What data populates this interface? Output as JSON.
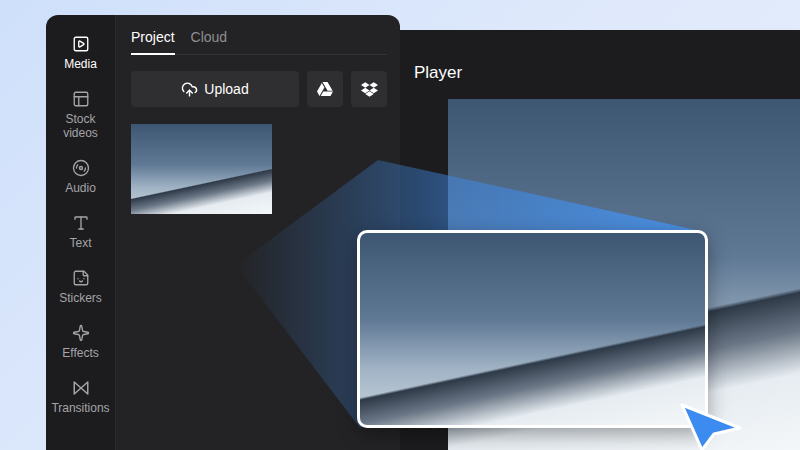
{
  "sidebar": {
    "items": [
      {
        "label": "Media",
        "selected": true
      },
      {
        "label": "Stock videos",
        "selected": false
      },
      {
        "label": "Audio",
        "selected": false
      },
      {
        "label": "Text",
        "selected": false
      },
      {
        "label": "Stickers",
        "selected": false
      },
      {
        "label": "Effects",
        "selected": false
      },
      {
        "label": "Transitions",
        "selected": false
      }
    ]
  },
  "media_panel": {
    "tabs": [
      {
        "label": "Project",
        "selected": true
      },
      {
        "label": "Cloud",
        "selected": false
      }
    ],
    "upload_button": "Upload"
  },
  "player": {
    "title": "Player"
  }
}
